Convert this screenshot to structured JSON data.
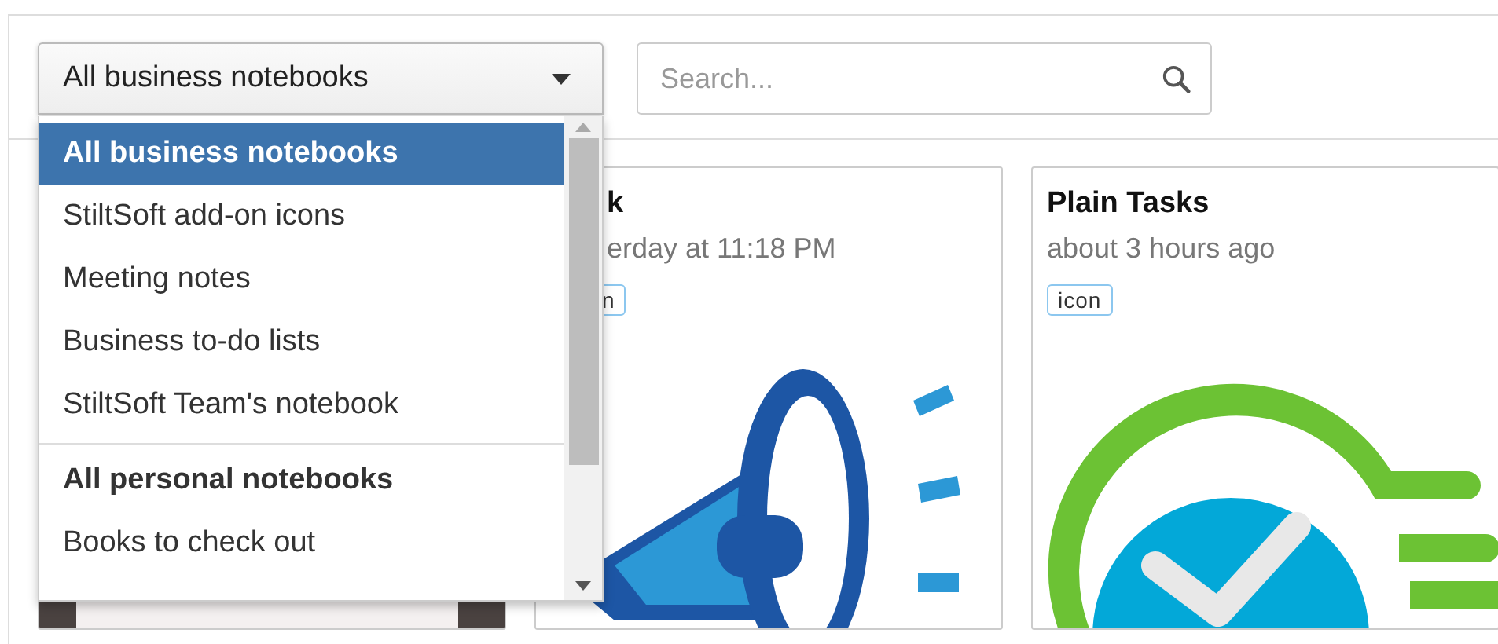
{
  "notebook_select": {
    "value": "All business notebooks",
    "expanded": true
  },
  "search": {
    "placeholder": "Search..."
  },
  "dropdown": {
    "items": [
      {
        "kind": "heading",
        "label": "All business notebooks",
        "selected": true
      },
      {
        "kind": "item",
        "label": "StiltSoft add-on icons",
        "selected": false
      },
      {
        "kind": "item",
        "label": "Meeting notes",
        "selected": false
      },
      {
        "kind": "item",
        "label": "Business to-do lists",
        "selected": false
      },
      {
        "kind": "item",
        "label": "StiltSoft Team's notebook",
        "selected": false
      },
      {
        "kind": "heading",
        "label": "All personal notebooks",
        "selected": false
      },
      {
        "kind": "item",
        "label": "Books to check out",
        "selected": false
      }
    ]
  },
  "notes": [
    {
      "kind": "covered",
      "image": {
        "kind": "photo"
      }
    },
    {
      "kind": "partly-covered",
      "title": "k",
      "updated": "erday at 11:18 PM",
      "tag": "n",
      "image": {
        "kind": "megaphone"
      }
    },
    {
      "kind": "full",
      "title": "Plain Tasks",
      "updated": "about 3 hours ago",
      "tag": "icon",
      "image": {
        "kind": "checkmark"
      }
    }
  ]
}
